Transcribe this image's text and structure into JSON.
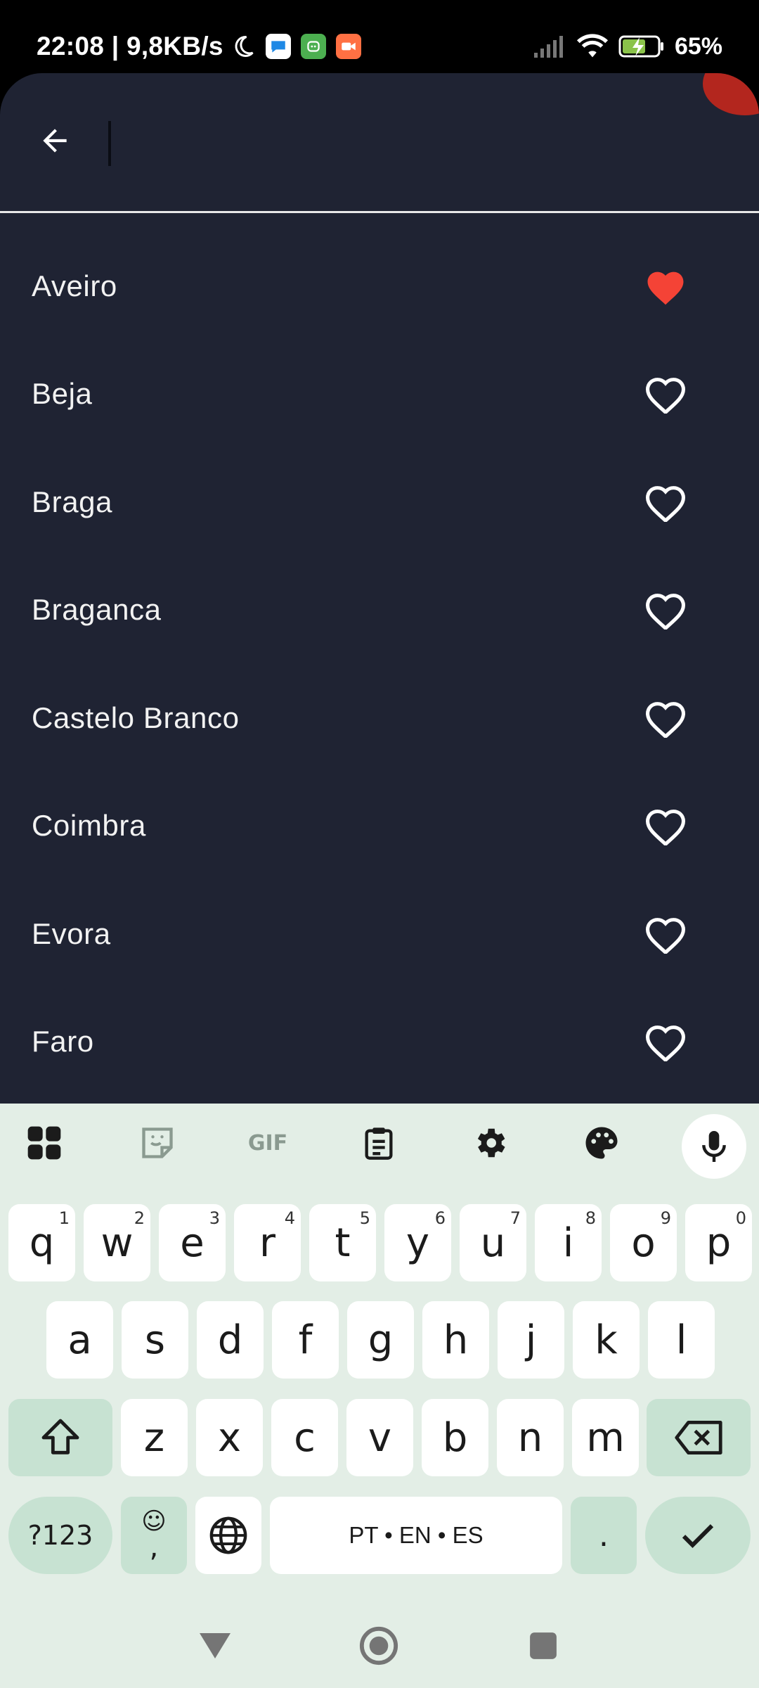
{
  "status_bar": {
    "time_speed": "22:08 | 9,8KB/s",
    "battery": "65%"
  },
  "search": {
    "placeholder": "",
    "value": ""
  },
  "districts": [
    {
      "name": "Aveiro",
      "favorite": true
    },
    {
      "name": "Beja",
      "favorite": false
    },
    {
      "name": "Braga",
      "favorite": false
    },
    {
      "name": "Braganca",
      "favorite": false
    },
    {
      "name": "Castelo Branco",
      "favorite": false
    },
    {
      "name": "Coimbra",
      "favorite": false
    },
    {
      "name": "Evora",
      "favorite": false
    },
    {
      "name": "Faro",
      "favorite": false
    }
  ],
  "colors": {
    "sheet_bg": "#1f2333",
    "favorite_heart": "#f44336",
    "keyboard_bg": "#e3eee6",
    "modifier_key": "#c7e2d2"
  },
  "keyboard": {
    "row1": [
      {
        "key": "q",
        "sup": "1"
      },
      {
        "key": "w",
        "sup": "2"
      },
      {
        "key": "e",
        "sup": "3"
      },
      {
        "key": "r",
        "sup": "4"
      },
      {
        "key": "t",
        "sup": "5"
      },
      {
        "key": "y",
        "sup": "6"
      },
      {
        "key": "u",
        "sup": "7"
      },
      {
        "key": "i",
        "sup": "8"
      },
      {
        "key": "o",
        "sup": "9"
      },
      {
        "key": "p",
        "sup": "0"
      }
    ],
    "row2": [
      "a",
      "s",
      "d",
      "f",
      "g",
      "h",
      "j",
      "k",
      "l"
    ],
    "row3": [
      "z",
      "x",
      "c",
      "v",
      "b",
      "n",
      "m"
    ],
    "symbols_label": "?123",
    "emoji_top": "☺",
    "emoji_bottom": ",",
    "space_label": "PT • EN • ES",
    "period_label": ".",
    "gif_label": "GIF"
  }
}
